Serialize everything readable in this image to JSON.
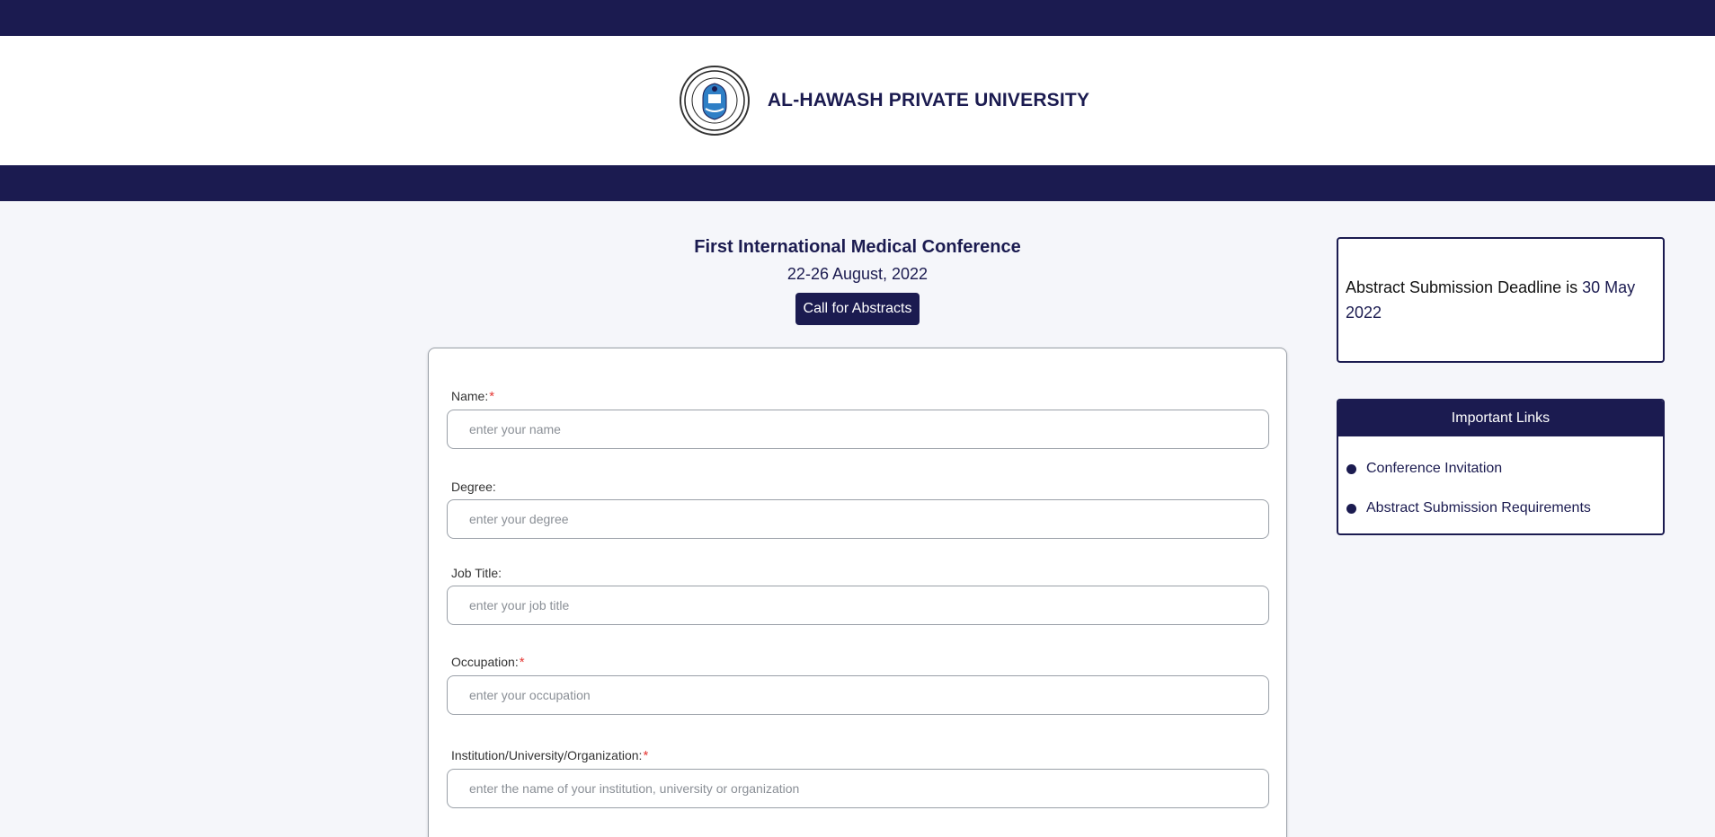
{
  "header": {
    "university_name": "AL-HAWASH PRIVATE UNIVERSITY",
    "logo_icon": "university-seal-icon"
  },
  "conference": {
    "title": "First International Medical Conference",
    "date": "22-26 August, 2022",
    "cta_label": "Call for Abstracts"
  },
  "form": {
    "fields": [
      {
        "label": "Name:",
        "required": true,
        "placeholder": "enter your name",
        "value": ""
      },
      {
        "label": "Degree:",
        "required": false,
        "placeholder": "enter your degree",
        "value": ""
      },
      {
        "label": "Job Title:",
        "required": false,
        "placeholder": "enter your job title",
        "value": ""
      },
      {
        "label": "Occupation:",
        "required": true,
        "placeholder": "enter your occupation",
        "value": ""
      },
      {
        "label": "Institution/University/Organization:",
        "required": true,
        "placeholder": "enter the name of your institution, university or organization",
        "value": ""
      }
    ],
    "required_marker": "*"
  },
  "sidebar": {
    "deadline_prefix": "Abstract Submission Deadline is ",
    "deadline_date": "30 May 2022",
    "links_title": "Important Links",
    "links": [
      {
        "label": "Conference Invitation"
      },
      {
        "label": "Abstract Submission Requirements"
      }
    ]
  },
  "colors": {
    "navy": "#1b1b50",
    "required": "#e53935",
    "background": "#f5f6fa"
  }
}
